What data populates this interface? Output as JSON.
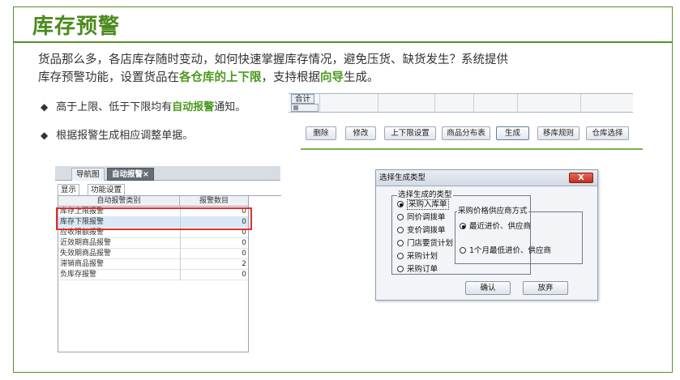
{
  "title": "库存预警",
  "intro": {
    "line1": "货品那么多，各店库存随时变动，如何快速掌握库存情况，避免压货、缺货发生？系统提供",
    "line2_a": "库存预警功能，设置货品在",
    "line2_hl1": "各仓库的上下限",
    "line2_b": "，支持根据",
    "line2_hl2": "向导",
    "line2_c": "生成。"
  },
  "bullets": [
    {
      "a": "高于上限、低于下限均有",
      "hl": "自动报警",
      "b": "通知。"
    },
    {
      "a": "根据报警生成相应调整单据。"
    }
  ],
  "toolbar": {
    "total_label": "合计",
    "buttons": [
      "删除",
      "修改",
      "上下限设置",
      "商品分布表",
      "生成",
      "移库规则",
      "仓库选择"
    ]
  },
  "alarm_panel": {
    "tabs": [
      "导航图",
      "自动报警×"
    ],
    "subtabs": [
      "显示",
      "功能设置"
    ],
    "columns": [
      "自动报警类别",
      "报警数目"
    ],
    "rows": [
      {
        "name": "库存上限报警",
        "count": "0"
      },
      {
        "name": "库存下限报警",
        "count": "0"
      },
      {
        "name": "应收限额报警",
        "count": "0"
      },
      {
        "name": "近效期商品报警",
        "count": "0"
      },
      {
        "name": "失效期商品报警",
        "count": "0"
      },
      {
        "name": "滞销商品报警",
        "count": "2"
      },
      {
        "name": "负库存报警",
        "count": "0"
      }
    ]
  },
  "dialog": {
    "title": "选择生成类型",
    "close": "X",
    "group1_label": "选择生成的类型",
    "group1_options": [
      "采购入库单",
      "同价调拨单",
      "变价调拨单",
      "门店要货计划",
      "采购计划",
      "采购订单"
    ],
    "group2_label": "采购价格供应商方式",
    "group2_options": [
      "最近进价、供应商",
      "1个月最低进价、供应商"
    ],
    "ok": "确认",
    "cancel": "放弃"
  }
}
